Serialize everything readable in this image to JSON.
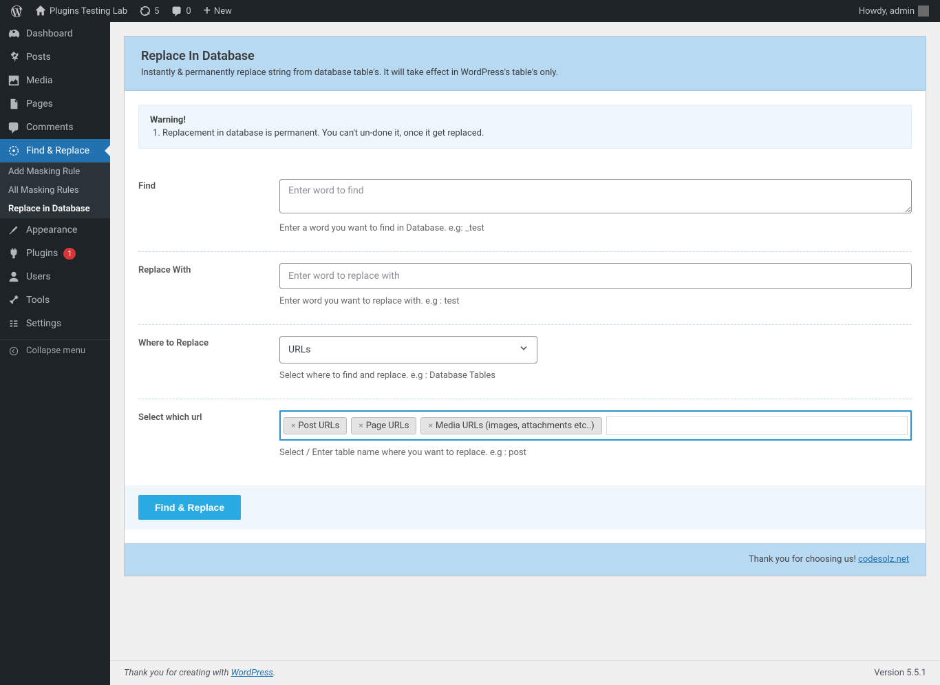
{
  "adminbar": {
    "site_name": "Plugins Testing Lab",
    "updates_count": "5",
    "comments_count": "0",
    "new_label": "New",
    "howdy": "Howdy, admin"
  },
  "sidebar": {
    "dashboard": "Dashboard",
    "posts": "Posts",
    "media": "Media",
    "pages": "Pages",
    "comments": "Comments",
    "find_replace": "Find & Replace",
    "sub_add_masking": "Add Masking Rule",
    "sub_all_masking": "All Masking Rules",
    "sub_replace_db": "Replace in Database",
    "appearance": "Appearance",
    "plugins": "Plugins",
    "plugins_badge": "1",
    "users": "Users",
    "tools": "Tools",
    "settings": "Settings",
    "collapse": "Collapse menu"
  },
  "page": {
    "title": "Replace In Database",
    "subtitle": "Instantly & permanently replace string from database table's. It will take effect in WordPress's table's only.",
    "warning_title": "Warning!",
    "warning_1": "Replacement in database is permanent. You can't un-done it, once it get replaced.",
    "fields": {
      "find_label": "Find",
      "find_placeholder": "Enter word to find",
      "find_help": "Enter a word you want to find in Database. e.g: _test",
      "replace_label": "Replace With",
      "replace_placeholder": "Enter word to replace with",
      "replace_help": "Enter word you want to replace with. e.g : test",
      "where_label": "Where to Replace",
      "where_value": "URLs",
      "where_help": "Select where to find and replace. e.g : Database Tables",
      "url_label": "Select which url",
      "url_help": "Select / Enter table name where you want to replace. e.g : post",
      "url_tags": [
        "Post URLs",
        "Page URLs",
        "Media URLs (images, attachments etc..)"
      ]
    },
    "submit": "Find & Replace",
    "thanks": "Thank you for choosing us! ",
    "thanks_link": "codesolz.net"
  },
  "footer": {
    "text": "Thank you for creating with ",
    "link": "WordPress",
    "version": "Version 5.5.1"
  }
}
